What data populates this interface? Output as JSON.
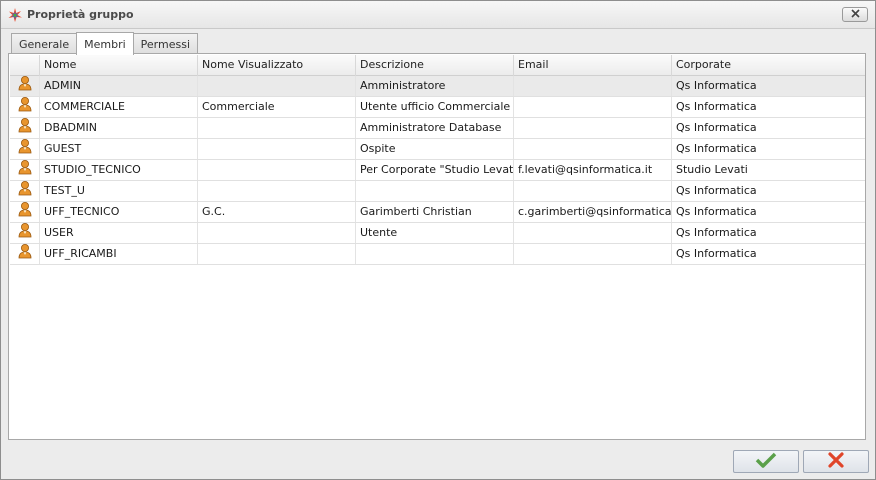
{
  "window": {
    "title": "Proprietà gruppo"
  },
  "tabs": [
    {
      "label": "Generale",
      "active": false
    },
    {
      "label": "Membri",
      "active": true
    },
    {
      "label": "Permessi",
      "active": false
    }
  ],
  "table": {
    "columns": [
      "Nome",
      "Nome Visualizzato",
      "Descrizione",
      "Email",
      "Corporate"
    ],
    "rows": [
      [
        "ADMIN",
        "",
        "Amministratore",
        "",
        "Qs Informatica"
      ],
      [
        "COMMERCIALE",
        "Commerciale",
        "Utente ufficio Commerciale",
        "",
        "Qs Informatica"
      ],
      [
        "DBADMIN",
        "",
        "Amministratore Database",
        "",
        "Qs Informatica"
      ],
      [
        "GUEST",
        "",
        "Ospite",
        "",
        "Qs Informatica"
      ],
      [
        "STUDIO_TECNICO",
        "",
        "Per Corporate \"Studio Levati\"",
        "f.levati@qsinformatica.it",
        "Studio Levati"
      ],
      [
        "TEST_U",
        "",
        "",
        "",
        "Qs Informatica"
      ],
      [
        "UFF_TECNICO",
        "G.C.",
        "Garimberti Christian",
        "c.garimberti@qsinformatica.it",
        "Qs Informatica"
      ],
      [
        "USER",
        "",
        "Utente",
        "",
        "Qs Informatica"
      ],
      [
        "UFF_RICAMBI",
        "",
        "",
        "",
        "Qs Informatica"
      ]
    ],
    "selected_row": 0,
    "row_icon": "user-icon"
  },
  "icons": {
    "window": "app-star-icon",
    "close": "close-icon",
    "ok": "checkmark-icon",
    "cancel": "cross-icon"
  },
  "colors": {
    "ok": "#5aa04a",
    "cancel": "#e0452a",
    "user_icon": "#e0912c"
  }
}
